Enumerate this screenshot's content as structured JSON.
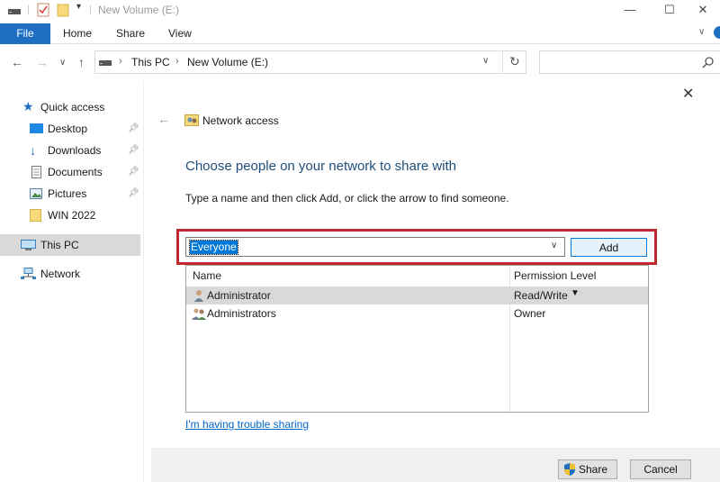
{
  "window": {
    "title": "New Volume (E:)",
    "controls": {
      "minimize": "—",
      "maximize": "☐",
      "close": "✕"
    }
  },
  "ribbon": {
    "tabs": [
      "File",
      "Home",
      "Share",
      "View"
    ]
  },
  "address": {
    "path": [
      "This PC",
      "New Volume (E:)"
    ],
    "search_placeholder": ""
  },
  "nav": {
    "items": [
      {
        "label": "Quick access",
        "icon": "star-icon"
      },
      {
        "label": "Desktop",
        "icon": "desktop-icon",
        "pinned": true
      },
      {
        "label": "Downloads",
        "icon": "download-arrow-icon",
        "pinned": true
      },
      {
        "label": "Documents",
        "icon": "documents-icon",
        "pinned": true
      },
      {
        "label": "Pictures",
        "icon": "pictures-icon",
        "pinned": true
      },
      {
        "label": "WIN 2022",
        "icon": "folder-icon"
      },
      {
        "label": "This PC",
        "icon": "computer-icon",
        "selected": true
      },
      {
        "label": "Network",
        "icon": "network-icon"
      }
    ]
  },
  "dialog": {
    "header": "Network access",
    "heading": "Choose people on your network to share with",
    "instruction": "Type a name and then click Add, or click the arrow to find someone.",
    "input_value": "Everyone",
    "add_label": "Add",
    "columns": {
      "name": "Name",
      "permission": "Permission Level"
    },
    "rows": [
      {
        "name": "Administrator",
        "permission": "Read/Write",
        "has_dropdown": true,
        "selected": true
      },
      {
        "name": "Administrators",
        "permission": "Owner",
        "has_dropdown": false,
        "selected": false
      }
    ],
    "trouble_link": "I'm having trouble sharing",
    "share_label": "Share",
    "cancel_label": "Cancel"
  },
  "colors": {
    "accent": "#1e6fc1",
    "highlight_border": "#c0282f",
    "selection": "#0078d7",
    "heading": "#1f4e79"
  }
}
